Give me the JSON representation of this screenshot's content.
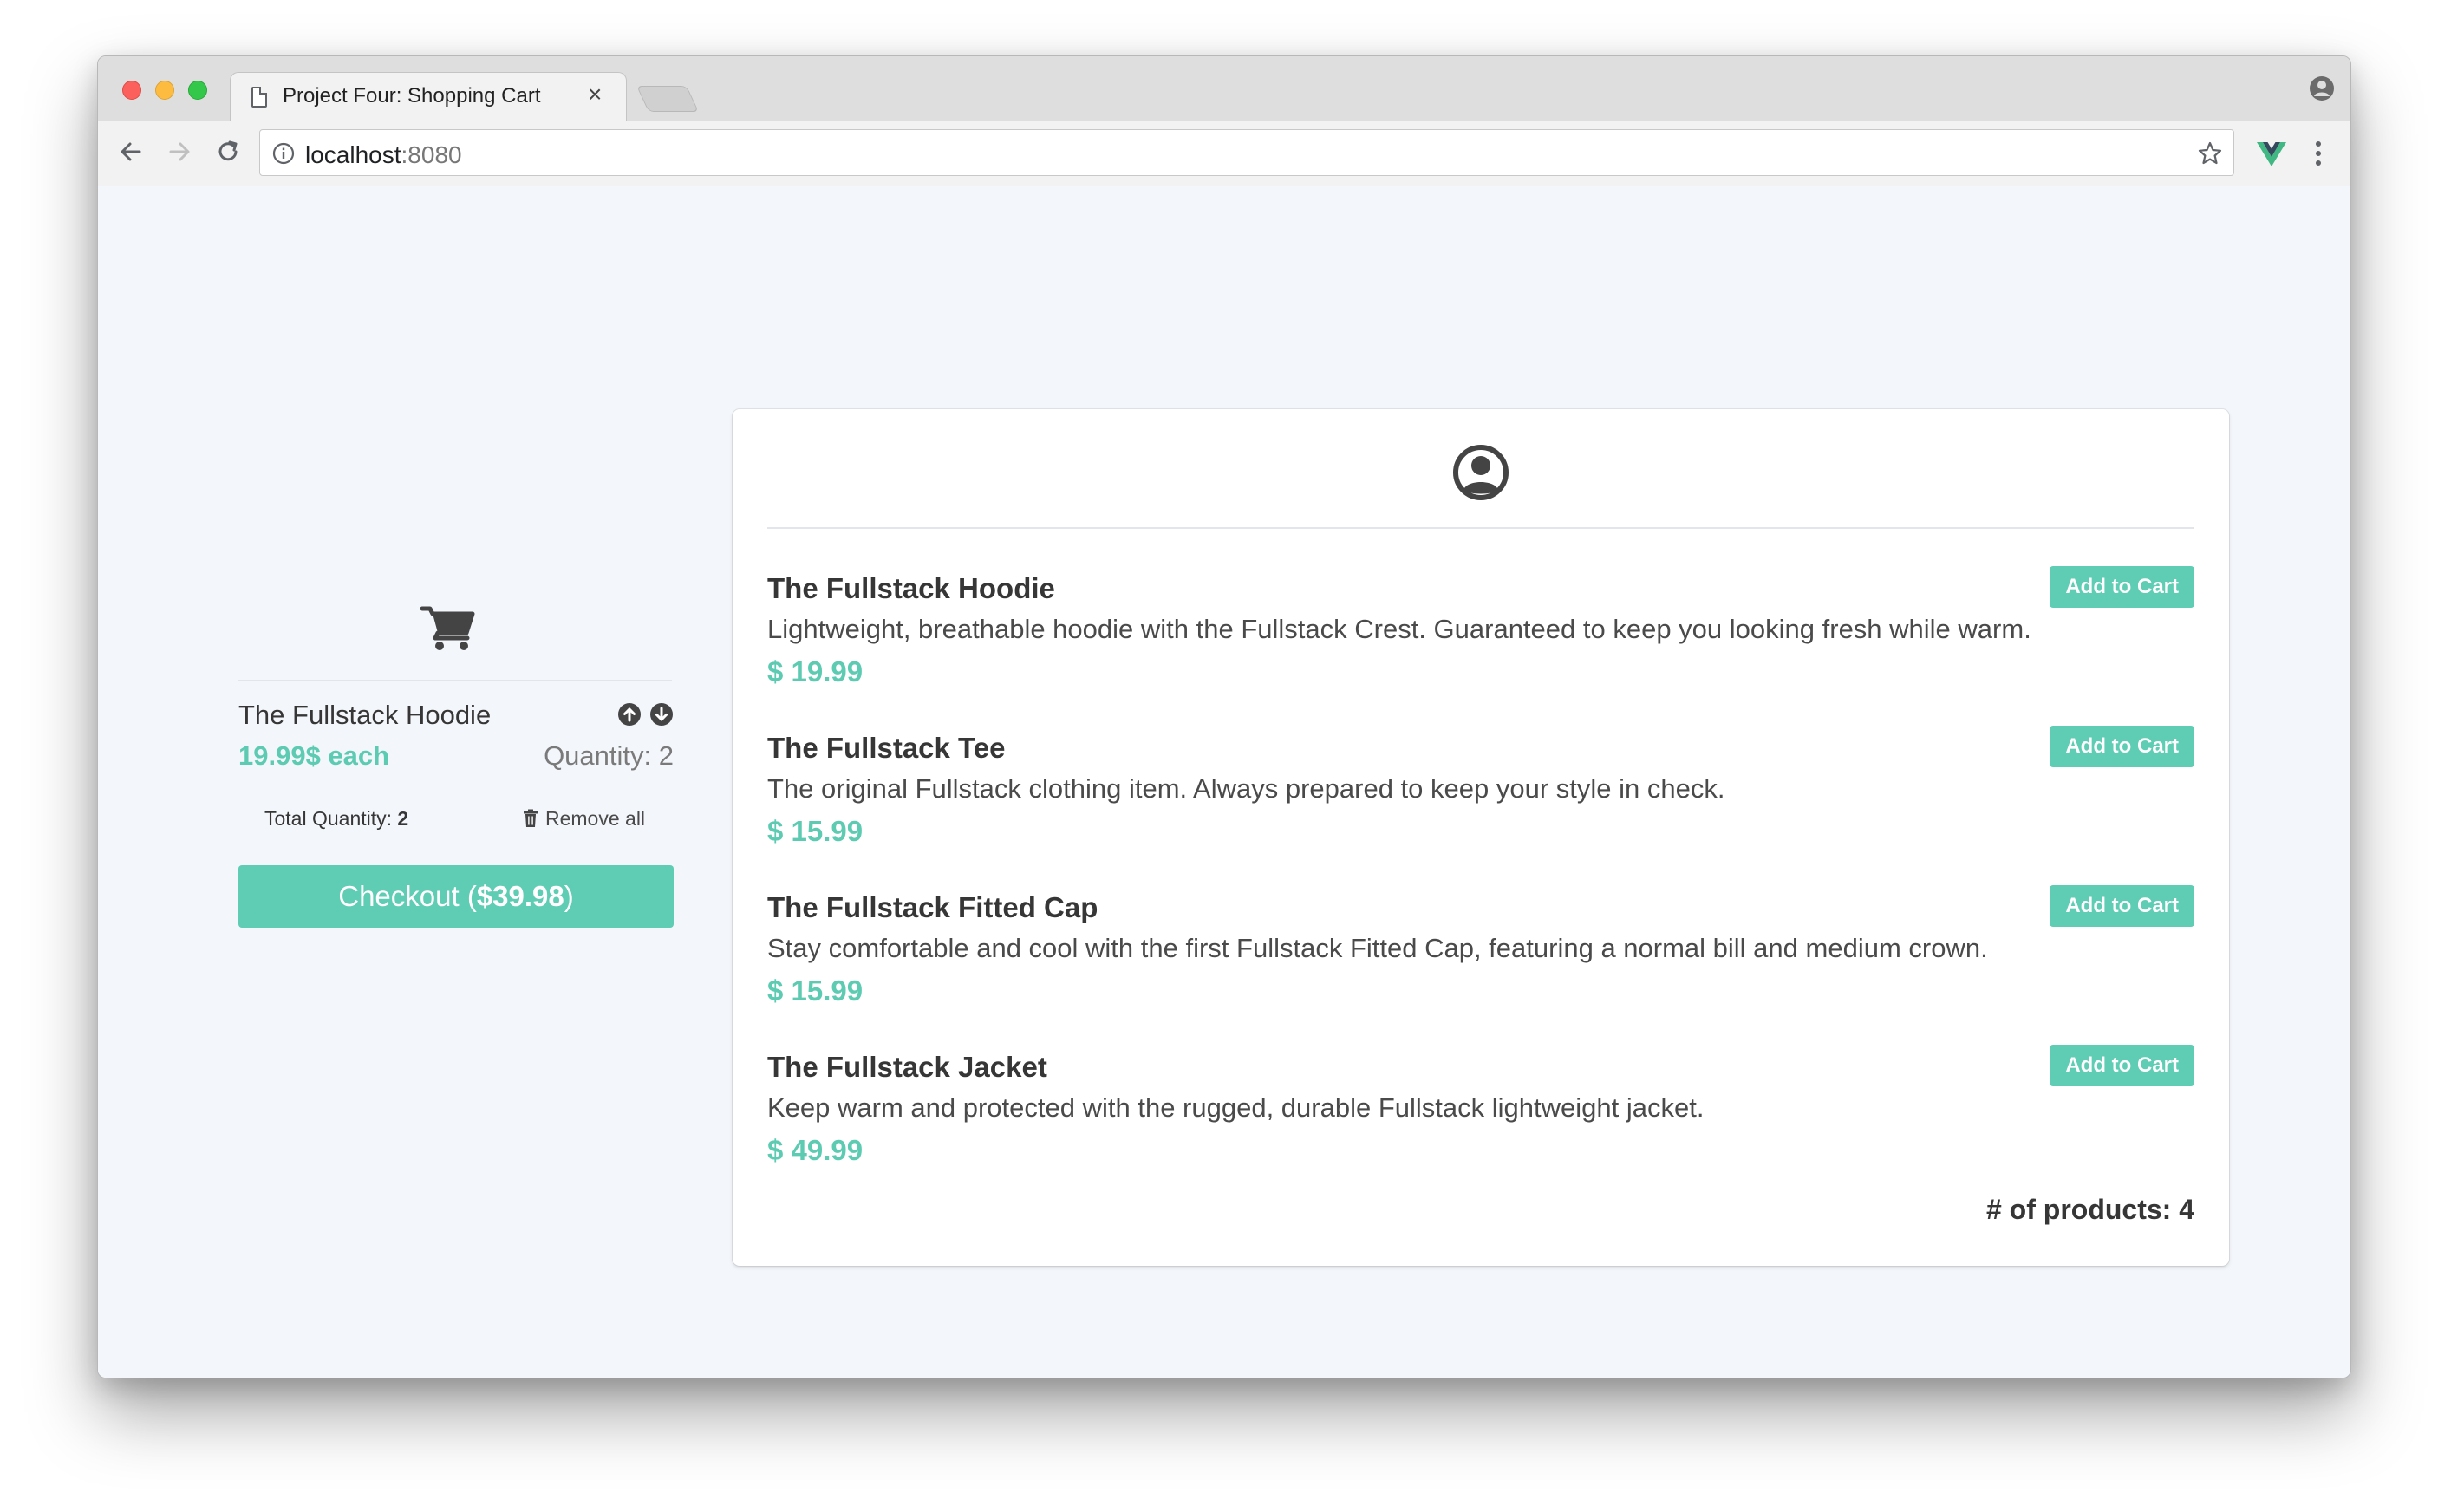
{
  "browser": {
    "tab_title": "Project Four: Shopping Cart",
    "tab_close": "×",
    "url_host": "localhost",
    "url_port": ":8080"
  },
  "cart": {
    "item": {
      "title": "The Fullstack Hoodie",
      "price_each": "19.99$ each",
      "quantity_label": "Quantity:",
      "quantity": "2"
    },
    "total_quantity_label": "Total Quantity:",
    "total_quantity": "2",
    "remove_all_label": "Remove all",
    "checkout_label": "Checkout (",
    "checkout_total": "$39.98",
    "checkout_suffix": ")"
  },
  "products": [
    {
      "name": "The Fullstack Hoodie",
      "description": "Lightweight, breathable hoodie with the Fullstack Crest. Guaranteed to keep you looking fresh while warm.",
      "price": "$ 19.99",
      "button": "Add to Cart"
    },
    {
      "name": "The Fullstack Tee",
      "description": "The original Fullstack clothing item. Always prepared to keep your style in check.",
      "price": "$ 15.99",
      "button": "Add to Cart"
    },
    {
      "name": "The Fullstack Fitted Cap",
      "description": "Stay comfortable and cool with the first Fullstack Fitted Cap, featuring a normal bill and medium crown.",
      "price": "$ 15.99",
      "button": "Add to Cart"
    },
    {
      "name": "The Fullstack Jacket",
      "description": "Keep warm and protected with the rugged, durable Fullstack lightweight jacket.",
      "price": "$ 49.99",
      "button": "Add to Cart"
    }
  ],
  "product_count_label": "# of products: 4",
  "colors": {
    "accent": "#5ecdb3",
    "page_background": "#f3f6fa",
    "text_dark": "#363636"
  },
  "icons": {
    "tab": "document-icon",
    "nav": [
      "back-arrow-icon",
      "forward-arrow-icon",
      "reload-icon"
    ],
    "omnibox": [
      "info-icon",
      "star-icon"
    ],
    "extensions": [
      "vue-devtools-icon",
      "menu-dots-icon"
    ],
    "profile": "profile-icon",
    "cart": "shopping-cart-icon",
    "panel_header": "user-circle-icon",
    "cart_controls": [
      "arrow-circle-up-icon",
      "arrow-circle-down-icon",
      "trash-icon"
    ]
  }
}
